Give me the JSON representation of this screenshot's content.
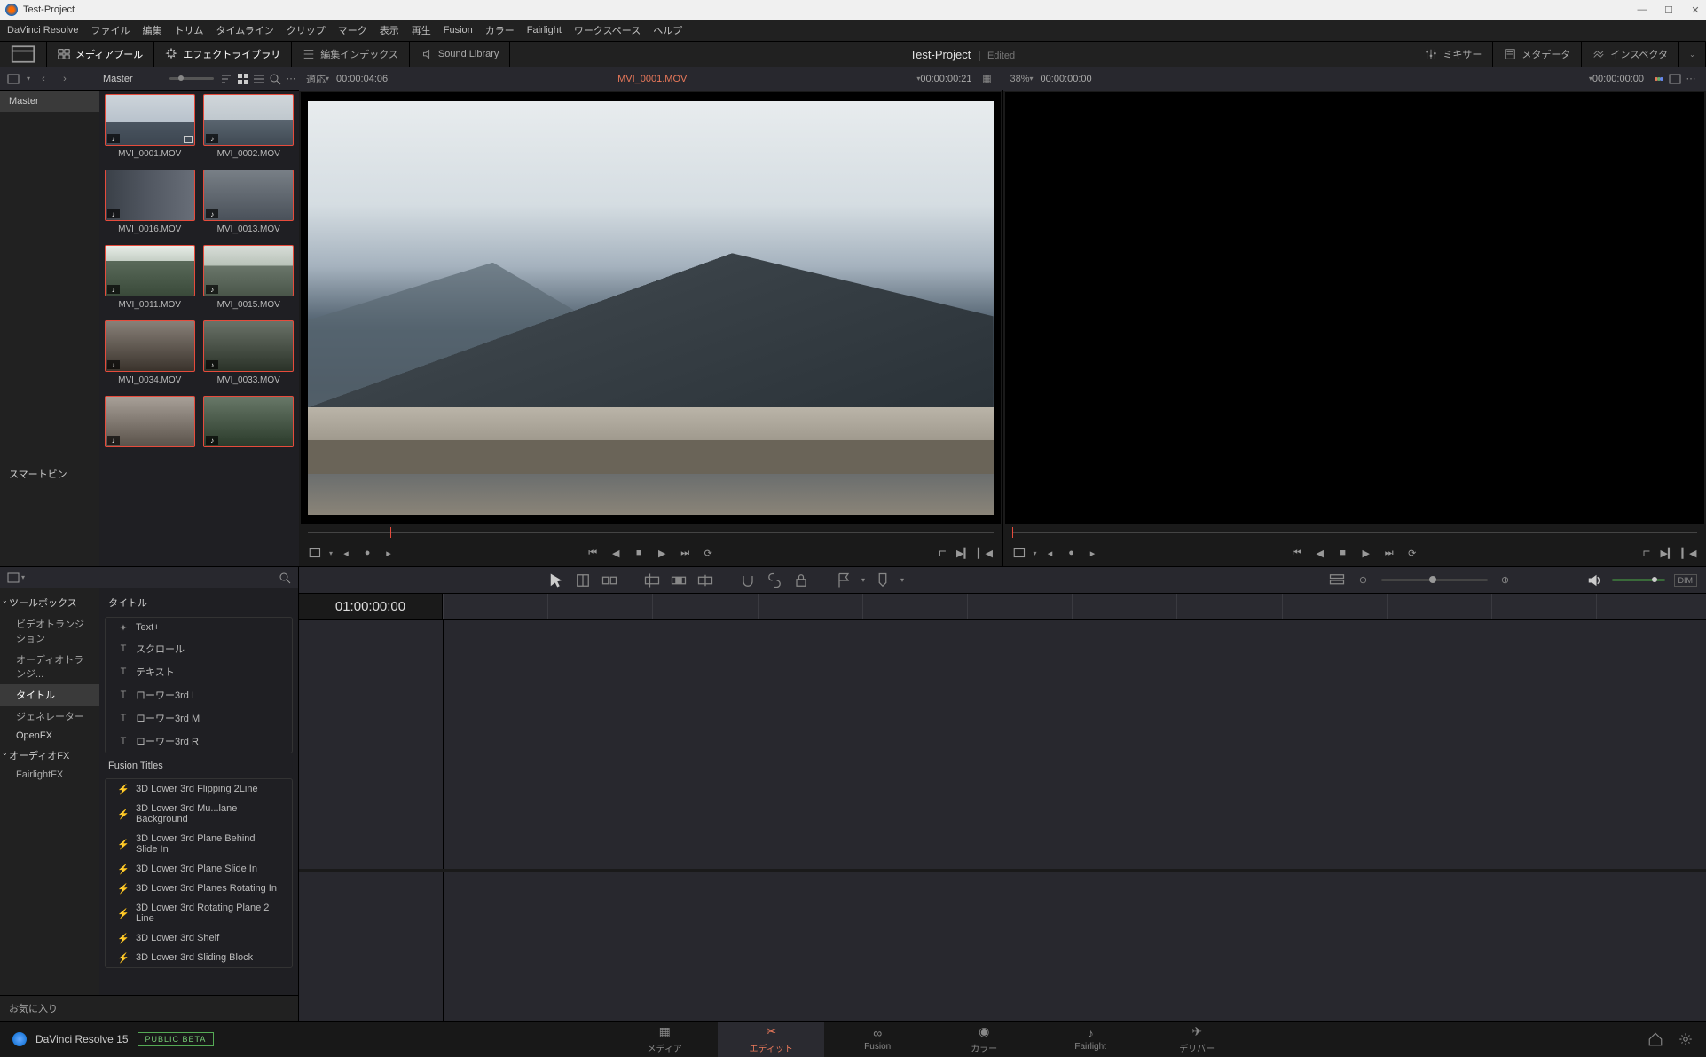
{
  "window": {
    "title": "Test-Project"
  },
  "menubar": [
    "DaVinci Resolve",
    "ファイル",
    "編集",
    "トリム",
    "タイムライン",
    "クリップ",
    "マーク",
    "表示",
    "再生",
    "Fusion",
    "カラー",
    "Fairlight",
    "ワークスペース",
    "ヘルプ"
  ],
  "toolbar": {
    "media_pool": "メディアプール",
    "effects_lib": "エフェクトライブラリ",
    "edit_index": "編集インデックス",
    "sound_lib": "Sound Library",
    "mixer": "ミキサー",
    "metadata": "メタデータ",
    "inspector": "インスペクタ"
  },
  "project": {
    "name": "Test-Project",
    "status": "Edited"
  },
  "bins": {
    "master": "Master",
    "smartbin": "スマートビン"
  },
  "clips": [
    {
      "name": "MVI_0001.MOV",
      "t": "t1"
    },
    {
      "name": "MVI_0002.MOV",
      "t": "t2"
    },
    {
      "name": "MVI_0016.MOV",
      "t": "t3"
    },
    {
      "name": "MVI_0013.MOV",
      "t": "t4"
    },
    {
      "name": "MVI_0011.MOV",
      "t": "t5"
    },
    {
      "name": "MVI_0015.MOV",
      "t": "t6"
    },
    {
      "name": "MVI_0034.MOV",
      "t": "t7"
    },
    {
      "name": "MVI_0033.MOV",
      "t": "t8"
    },
    {
      "name": "",
      "t": "t9"
    },
    {
      "name": "",
      "t": "t10"
    }
  ],
  "source_viewer": {
    "fit": "適応",
    "tc_in": "00:00:04:06",
    "clip_name": "MVI_0001.MOV",
    "tc_dur": "00:00:00:21"
  },
  "record_viewer": {
    "zoom": "38%",
    "tc_in": "00:00:00:00",
    "tc_dur": "00:00:00:00"
  },
  "timeline": {
    "tc": "01:00:00:00"
  },
  "fx": {
    "tree": {
      "toolbox": "ツールボックス",
      "video_trans": "ビデオトランジション",
      "audio_trans": "オーディオトランジ...",
      "titles": "タイトル",
      "generators": "ジェネレーター",
      "openfx": "OpenFX",
      "audiofx": "オーディオFX",
      "fairlightfx": "FairlightFX"
    },
    "section_titles": "タイトル",
    "titles_list": [
      "Text+",
      "スクロール",
      "テキスト",
      "ローワー3rd L",
      "ローワー3rd M",
      "ローワー3rd R"
    ],
    "fusion_section": "Fusion Titles",
    "fusion_list": [
      "3D Lower 3rd Flipping 2Line",
      "3D Lower 3rd Mu...lane Background",
      "3D Lower 3rd Plane Behind Slide In",
      "3D Lower 3rd Plane Slide In",
      "3D Lower 3rd Planes Rotating In",
      "3D Lower 3rd Rotating Plane 2 Line",
      "3D Lower 3rd Shelf",
      "3D Lower 3rd Sliding Block"
    ],
    "favorites": "お気に入り"
  },
  "tl_toolbar": {
    "dim": "DIM"
  },
  "bottom": {
    "app": "DaVinci Resolve 15",
    "badge": "PUBLIC BETA",
    "tabs": {
      "media": "メディア",
      "edit": "エディット",
      "fusion": "Fusion",
      "color": "カラー",
      "fairlight": "Fairlight",
      "deliver": "デリバー"
    }
  }
}
